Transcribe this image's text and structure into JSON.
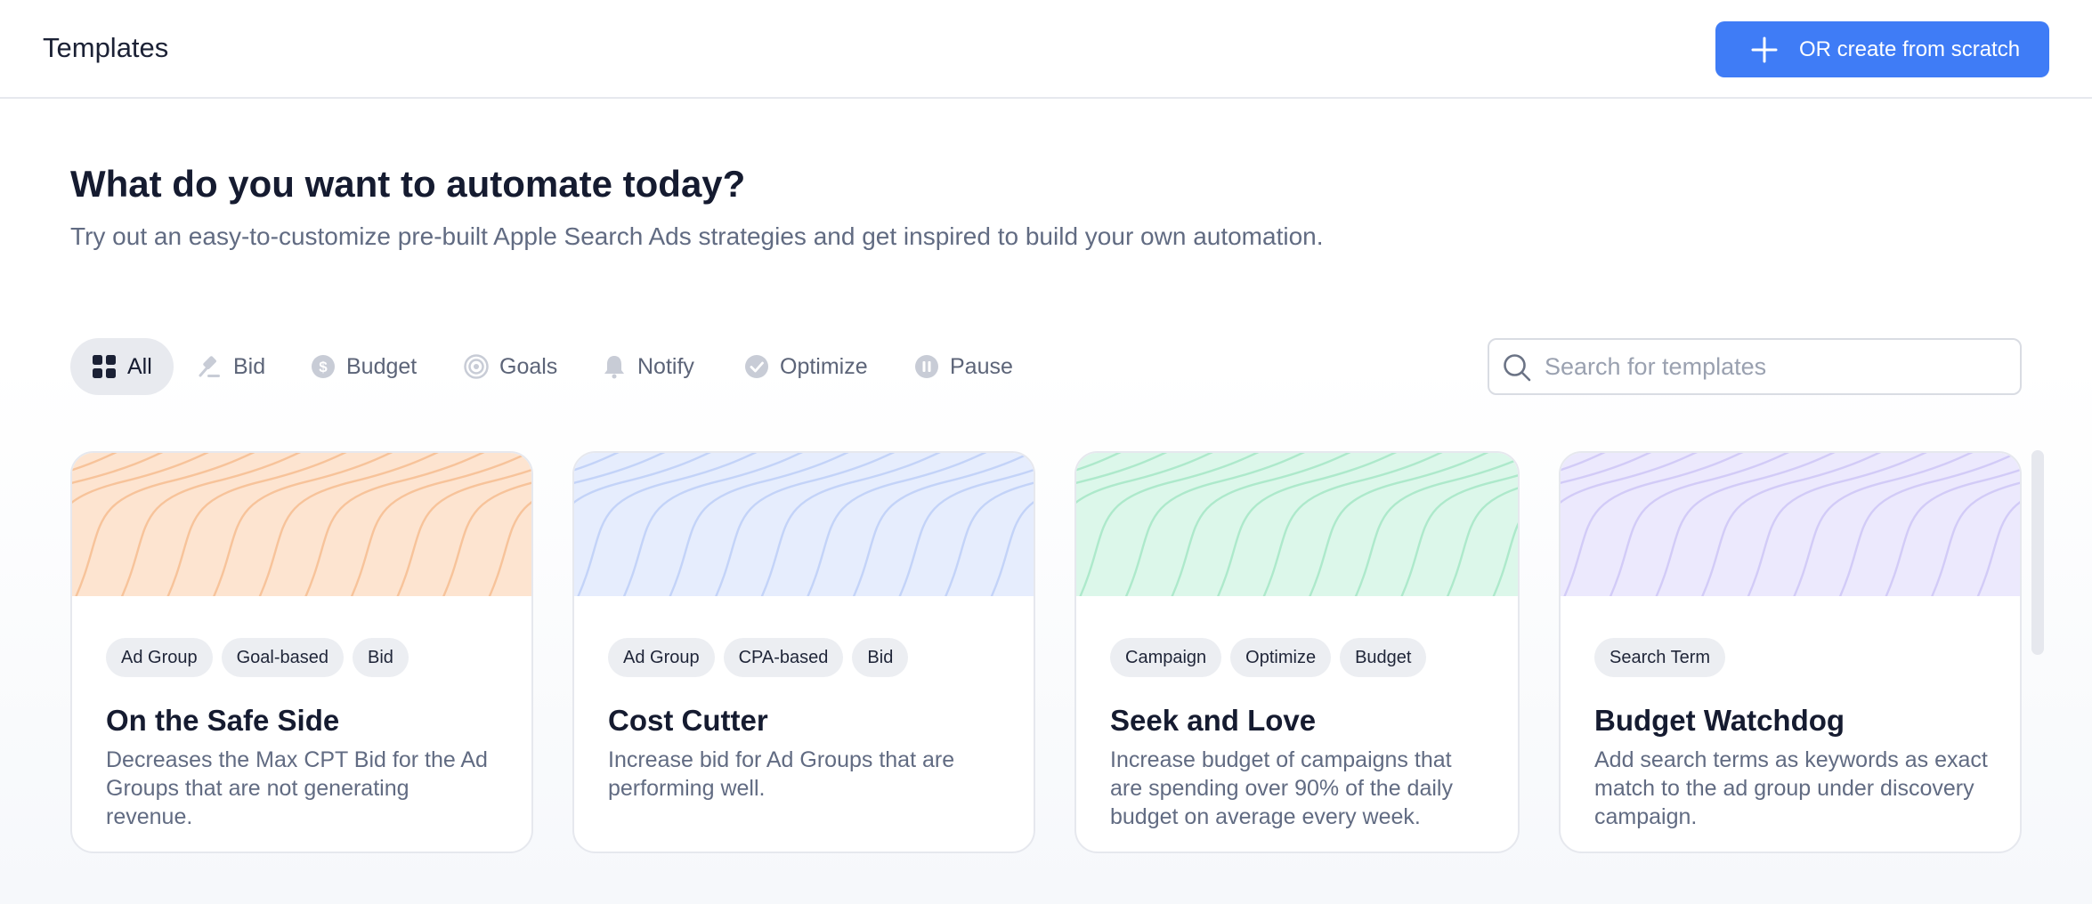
{
  "header": {
    "title": "Templates",
    "create_button_label": "OR create from scratch"
  },
  "hero": {
    "title": "What do you want to automate today?",
    "subtitle": "Try out an easy-to-customize pre-built Apple Search Ads strategies and get inspired to build your own automation."
  },
  "filters": [
    {
      "label": "All",
      "icon": "grid-icon",
      "active": true
    },
    {
      "label": "Bid",
      "icon": "gavel-icon",
      "active": false
    },
    {
      "label": "Budget",
      "icon": "dollar-icon",
      "active": false
    },
    {
      "label": "Goals",
      "icon": "target-icon",
      "active": false
    },
    {
      "label": "Notify",
      "icon": "bell-icon",
      "active": false
    },
    {
      "label": "Optimize",
      "icon": "check-circle-icon",
      "active": false
    },
    {
      "label": "Pause",
      "icon": "pause-icon",
      "active": false
    }
  ],
  "search": {
    "placeholder": "Search for templates",
    "value": ""
  },
  "cards": [
    {
      "tags": [
        "Ad Group",
        "Goal-based",
        "Bid"
      ],
      "title": "On the Safe Side",
      "description": "Decreases the Max CPT Bid for the Ad Groups that are not generating revenue.",
      "banner_bg": "#fde4d0",
      "banner_line": "#f7c39a"
    },
    {
      "tags": [
        "Ad Group",
        "CPA-based",
        "Bid"
      ],
      "title": "Cost Cutter",
      "description": "Increase bid for Ad Groups that are performing well.",
      "banner_bg": "#e6edfd",
      "banner_line": "#c3d3f8"
    },
    {
      "tags": [
        "Campaign",
        "Optimize",
        "Budget"
      ],
      "title": "Seek and Love",
      "description": "Increase budget of campaigns that are spending over 90% of the daily budget on average every week.",
      "banner_bg": "#dcf7ea",
      "banner_line": "#ade9cb"
    },
    {
      "tags": [
        "Search Term"
      ],
      "title": "Budget Watchdog",
      "description": "Add search terms as keywords as exact match to the ad group under discovery campaign.",
      "banner_bg": "#ece9fd",
      "banner_line": "#d2cbf7"
    }
  ],
  "colors": {
    "accent": "#3f7cf6",
    "muted_text": "#616b82",
    "active_filter_bg": "#e8eaef"
  }
}
